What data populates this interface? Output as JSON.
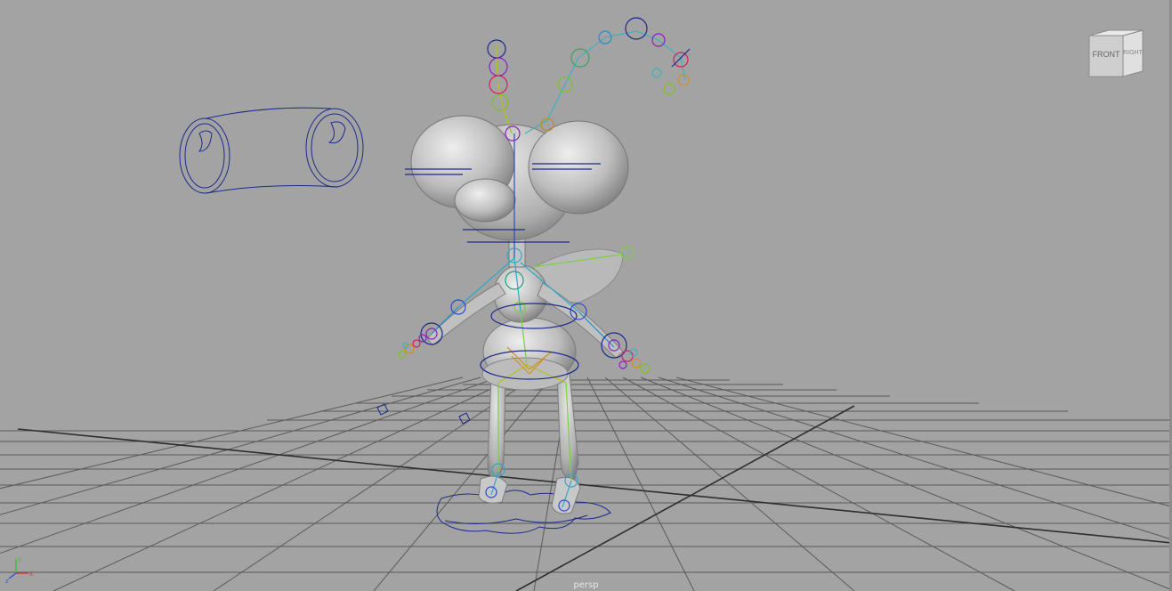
{
  "viewport": {
    "camera_label": "persp",
    "background_color": "#a3a3a3"
  },
  "viewcube": {
    "front_label": "FRONT",
    "right_label": "RIGHT"
  },
  "axis_gizmo": {
    "x_label": "x",
    "y_label": "y",
    "z_label": "z",
    "x_color": "#d03a3a",
    "y_color": "#3ac03a",
    "z_color": "#3a5ad0"
  },
  "scene": {
    "character": "rigged-insect-character",
    "icons": [
      "eye-look-at-control-icon",
      "foot-control-icon",
      "grid-floor"
    ]
  }
}
